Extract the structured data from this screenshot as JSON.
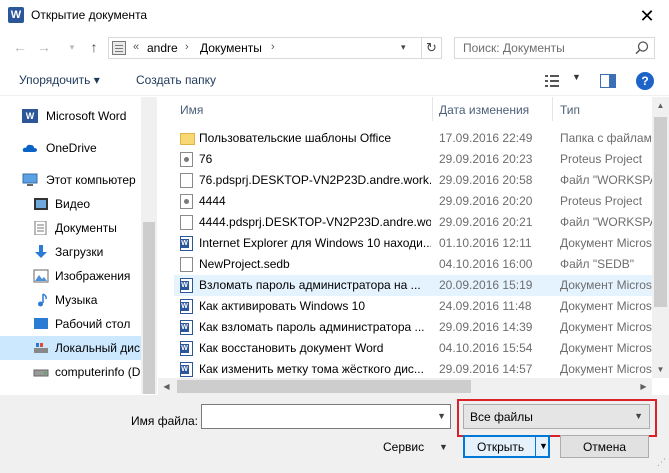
{
  "window": {
    "title": "Открытие документа",
    "app_icon": "word-icon",
    "close_glyph": "✕"
  },
  "address": {
    "breadcrumb_prefix": "«",
    "crumbs": [
      "andre",
      "Документы"
    ],
    "separator": "›"
  },
  "search": {
    "placeholder": "Поиск: Документы"
  },
  "toolbar": {
    "organize_label": "Упорядочить ▾",
    "new_folder_label": "Создать папку"
  },
  "nav_pane": {
    "items": [
      {
        "label": "Microsoft Word",
        "icon": "word-icon"
      },
      {
        "label": "OneDrive",
        "icon": "cloud-icon"
      },
      {
        "label": "Этот компьютер",
        "icon": "computer-icon"
      },
      {
        "label": "Видео",
        "icon": "video-folder-icon"
      },
      {
        "label": "Документы",
        "icon": "documents-folder-icon"
      },
      {
        "label": "Загрузки",
        "icon": "downloads-folder-icon"
      },
      {
        "label": "Изображения",
        "icon": "pictures-folder-icon"
      },
      {
        "label": "Музыка",
        "icon": "music-folder-icon"
      },
      {
        "label": "Рабочий стол",
        "icon": "desktop-folder-icon"
      },
      {
        "label": "Локальный дис",
        "icon": "local-disk-icon",
        "selected": true
      },
      {
        "label": "computerinfo (D",
        "icon": "drive-icon"
      }
    ]
  },
  "file_list": {
    "columns": {
      "name": "Имя",
      "date": "Дата изменения",
      "type": "Тип"
    },
    "rows": [
      {
        "name": "Пользовательские шаблоны Office",
        "date": "17.09.2016 22:49",
        "type": "Папка с файлами",
        "icon": "folder-icon"
      },
      {
        "name": "76",
        "date": "29.09.2016 20:23",
        "type": "Proteus Project",
        "icon": "proteus-file-icon"
      },
      {
        "name": "76.pdsprj.DESKTOP-VN2P23D.andre.work...",
        "date": "29.09.2016 20:58",
        "type": "Файл \"WORKSPA",
        "icon": "generic-file-icon"
      },
      {
        "name": "4444",
        "date": "29.09.2016 20:20",
        "type": "Proteus Project",
        "icon": "proteus-file-icon"
      },
      {
        "name": "4444.pdsprj.DESKTOP-VN2P23D.andre.wor...",
        "date": "29.09.2016 20:21",
        "type": "Файл \"WORKSPA",
        "icon": "generic-file-icon"
      },
      {
        "name": "Internet Explorer для Windows 10 находи...",
        "date": "01.10.2016 12:11",
        "type": "Документ Micros",
        "icon": "word-doc-icon"
      },
      {
        "name": "NewProject.sedb",
        "date": "04.10.2016 16:00",
        "type": "Файл \"SEDB\"",
        "icon": "generic-file-icon"
      },
      {
        "name": "Взломать пароль администратора на ...",
        "date": "20.09.2016 15:19",
        "type": "Документ Micros",
        "icon": "word-doc-icon",
        "highlighted": true
      },
      {
        "name": "Как активировать Windows 10",
        "date": "24.09.2016 11:48",
        "type": "Документ Micros",
        "icon": "word-doc-icon"
      },
      {
        "name": "Как взломать пароль администратора ...",
        "date": "29.09.2016 14:39",
        "type": "Документ Micros",
        "icon": "word-doc-icon"
      },
      {
        "name": "Как восстановить документ Word",
        "date": "04.10.2016 15:54",
        "type": "Документ Micros",
        "icon": "word-doc-icon"
      },
      {
        "name": "Как изменить метку тома жёсткого дис...",
        "date": "29.09.2016 14:57",
        "type": "Документ Micros",
        "icon": "word-doc-icon"
      }
    ]
  },
  "bottom": {
    "filename_label": "Имя файла:",
    "filename_value": "",
    "filter_value": "Все файлы",
    "service_label": "Сервис",
    "open_label": "Открыть",
    "cancel_label": "Отмена"
  },
  "colors": {
    "accent": "#0078d7",
    "selection": "#cce8ff",
    "hover": "#e5f3ff",
    "highlight_box": "#d8232a",
    "word_blue": "#2b579a"
  }
}
